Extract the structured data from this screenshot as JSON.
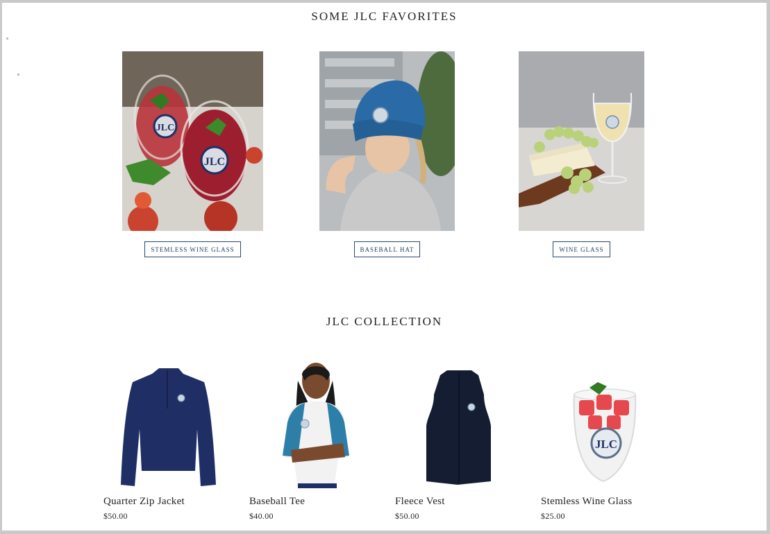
{
  "favorites": {
    "title": "SOME JLC FAVORITES",
    "items": [
      {
        "button": "STEMLESS WINE GLASS",
        "image": "red-sangria-glasses-with-logo"
      },
      {
        "button": "BASEBALL HAT",
        "image": "woman-in-blue-logo-cap"
      },
      {
        "button": "WINE GLASS",
        "image": "white-wine-cheese-grapes"
      }
    ]
  },
  "collection": {
    "title": "JLC COLLECTION",
    "items": [
      {
        "name": "Quarter Zip Jacket",
        "price": "$50.00",
        "image": "navy-quarter-zip-jacket"
      },
      {
        "name": "Baseball Tee",
        "price": "$40.00",
        "image": "woman-in-raglan-baseball-tee"
      },
      {
        "name": "Fleece Vest",
        "price": "$50.00",
        "image": "navy-fleece-vest"
      },
      {
        "name": "Stemless Wine Glass",
        "price": "$25.00",
        "image": "stemless-glass-with-logo"
      }
    ]
  },
  "colors": {
    "navy": "#1f2f66",
    "button_border": "#27476b",
    "cap_blue": "#2a6aa6",
    "tee_teal": "#2d7fa8"
  }
}
